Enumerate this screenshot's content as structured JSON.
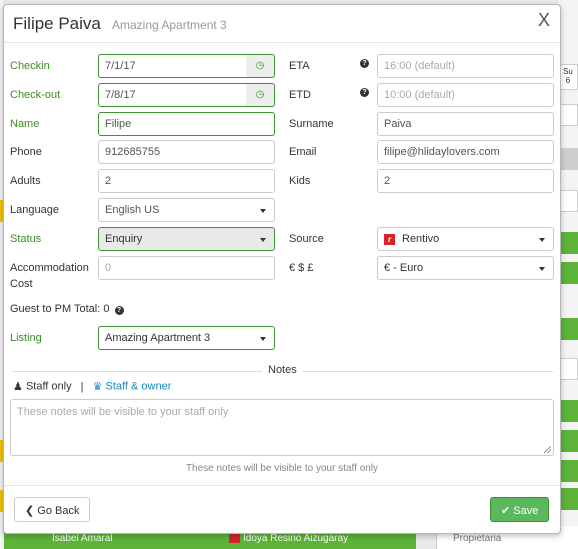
{
  "colors": {
    "accent_green": "#3a8c25",
    "link_blue": "#1a8bc6",
    "save_green": "#5cb85c",
    "brand_red": "#d9222a"
  },
  "header": {
    "guest_name": "Filipe Paiva",
    "listing": "Amazing Apartment 3",
    "close_label": "X"
  },
  "form": {
    "checkin": {
      "label": "Checkin",
      "value": "7/1/17",
      "icon": "clock-icon"
    },
    "checkout": {
      "label": "Check-out",
      "value": "7/8/17",
      "icon": "clock-icon"
    },
    "eta": {
      "label": "ETA",
      "placeholder": "16:00 (default)",
      "icon": "question-circle-icon"
    },
    "etd": {
      "label": "ETD",
      "placeholder": "10:00 (default)",
      "icon": "question-circle-icon"
    },
    "name": {
      "label": "Name",
      "value": "Filipe"
    },
    "surname": {
      "label": "Surname",
      "value": "Paiva"
    },
    "phone": {
      "label": "Phone",
      "value": "912685755"
    },
    "email": {
      "label": "Email",
      "value": "filipe@hlidaylovers.com"
    },
    "adults": {
      "label": "Adults",
      "value": "2"
    },
    "kids": {
      "label": "Kids",
      "value": "2"
    },
    "language": {
      "label": "Language",
      "value": "English US"
    },
    "status": {
      "label": "Status",
      "value": "Enquiry"
    },
    "source": {
      "label": "Source",
      "value": "Rentivo",
      "logo_letter": "r"
    },
    "accommodation_cost": {
      "label_line1": "Accommodation",
      "label_line2": "Cost",
      "placeholder": "0"
    },
    "currency": {
      "label": "€ $ £",
      "value": "€ - Euro"
    },
    "guest_to_pm_total": {
      "label": "Guest to PM Total: 0"
    },
    "listing": {
      "label": "Listing",
      "value": "Amazing Apartment 3"
    }
  },
  "notes": {
    "title": "Notes",
    "tab_staff_only": "Staff only",
    "tab_separator": "|",
    "tab_staff_owner": "Staff & owner",
    "textarea_placeholder": "These notes will be visible to your staff only",
    "hint": "These notes will be visible to your staff only"
  },
  "footer": {
    "back_label": "Go Back",
    "save_label": "Save"
  },
  "background": {
    "booking_a_guest": "Isabel Amaral",
    "booking_b_guest": "Idoya Resino Aizugaray",
    "booking_c_label": "Propietaria",
    "column_header": "Su",
    "column_header_num": "6"
  }
}
